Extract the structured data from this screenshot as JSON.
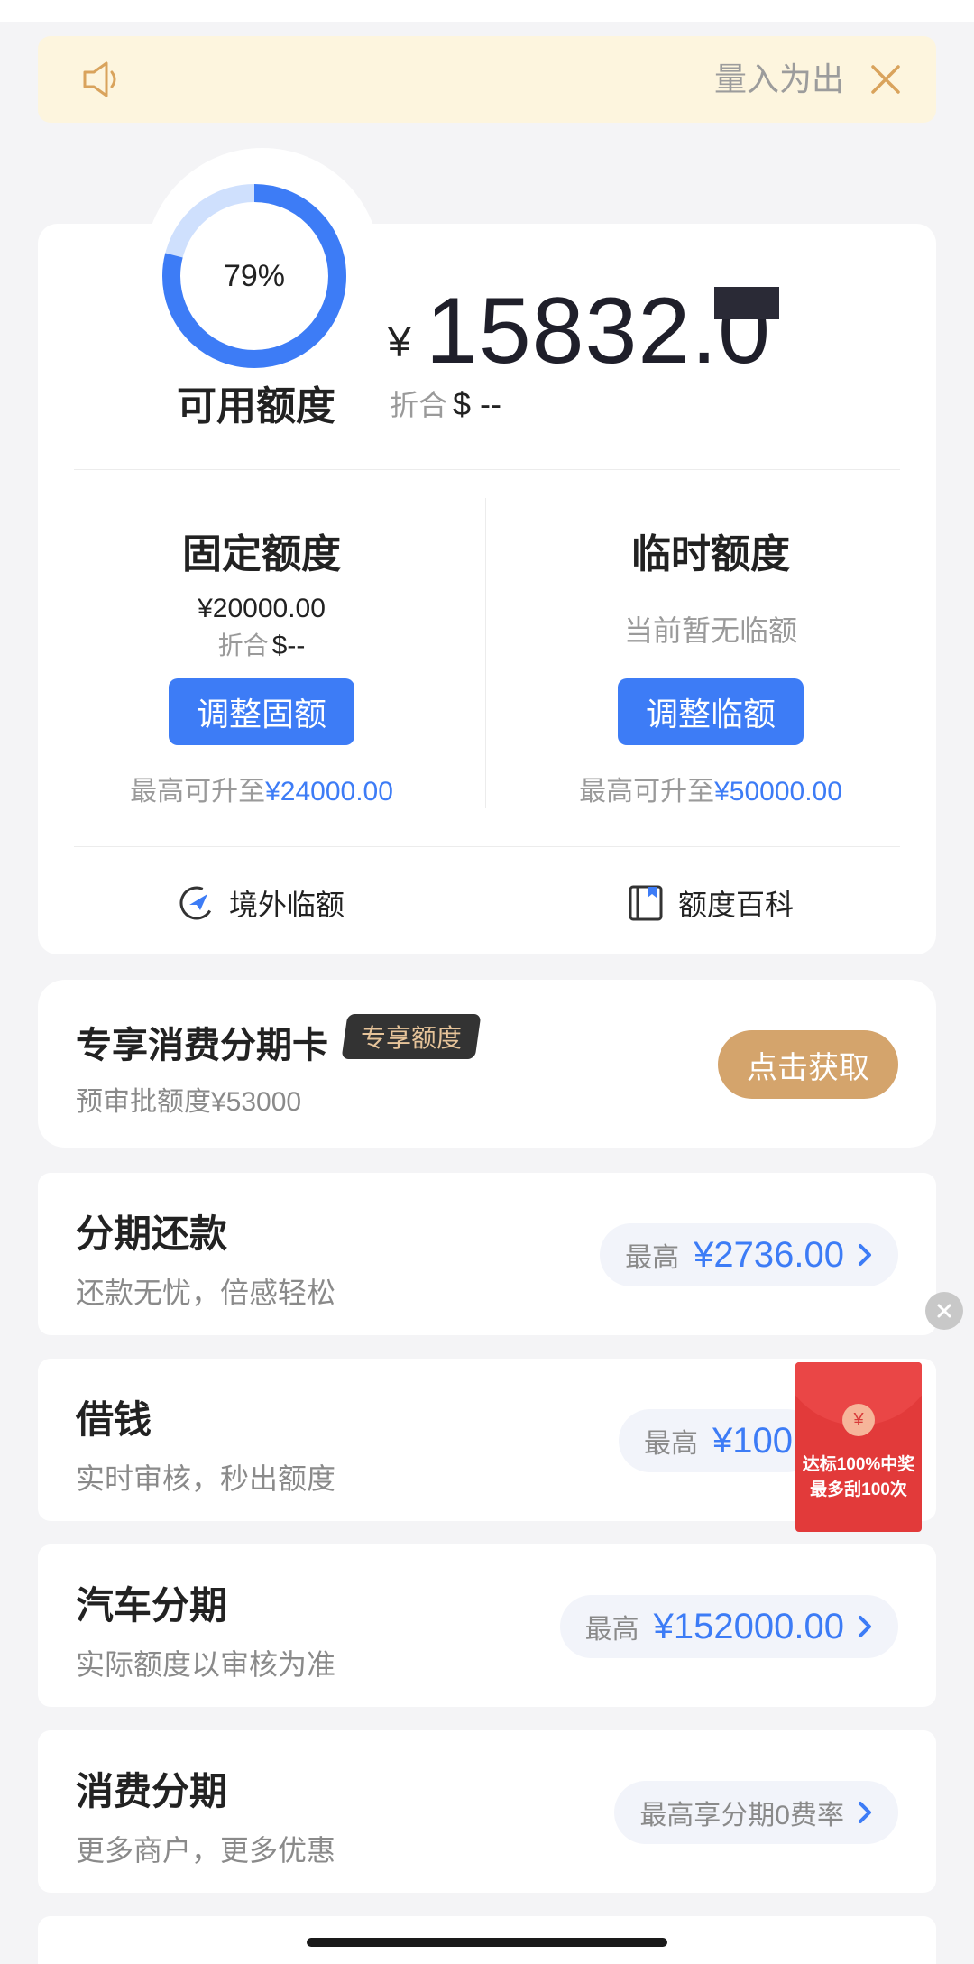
{
  "notice": {
    "text": "量入为出",
    "speaker_icon": "speaker-icon",
    "close_icon": "close-icon"
  },
  "credit": {
    "percent_value": 79,
    "percent_label": "79%",
    "available_label": "可用额度",
    "currency_symbol": "¥",
    "available_amount": "15832.0",
    "equiv_label": "折合",
    "equiv_value": "$ --",
    "fixed": {
      "title": "固定额度",
      "amount": "¥20000.00",
      "equiv_label": "折合",
      "equiv_value": "$--",
      "button": "调整固额",
      "max_prefix": "最高可升至",
      "max_value": "¥24000.00"
    },
    "temporary": {
      "title": "临时额度",
      "status": "当前暂无临额",
      "button": "调整临额",
      "max_prefix": "最高可升至",
      "max_value": "¥50000.00"
    },
    "links": [
      {
        "label": "境外临额",
        "icon": "plane-globe-icon"
      },
      {
        "label": "额度百科",
        "icon": "book-icon"
      }
    ]
  },
  "exclusive": {
    "title": "专享消费分期卡",
    "tag": "专享额度",
    "subtitle": "预审批额度¥53000",
    "button": "点击获取"
  },
  "products": [
    {
      "title": "分期还款",
      "subtitle": "还款无忧，倍感轻松",
      "pill_label": "最高",
      "pill_value": "¥2736.00"
    },
    {
      "title": "借钱",
      "subtitle": "实时审核，秒出额度",
      "pill_label": "最高",
      "pill_value": "¥100"
    },
    {
      "title": "汽车分期",
      "subtitle": "实际额度以审核为准",
      "pill_label": "最高",
      "pill_value": "¥152000.00"
    },
    {
      "title": "消费分期",
      "subtitle": "更多商户，更多优惠",
      "pill_label": "最高享分期0费率",
      "pill_value": ""
    }
  ],
  "promo": {
    "coin": "¥",
    "line1": "达标100%中奖",
    "line2": "最多刮100次"
  },
  "colors": {
    "accent": "#3d7cf6",
    "gold_button": "#d4a46c",
    "notice_bg": "#fdf5de",
    "envelope": "#e23a3a"
  }
}
